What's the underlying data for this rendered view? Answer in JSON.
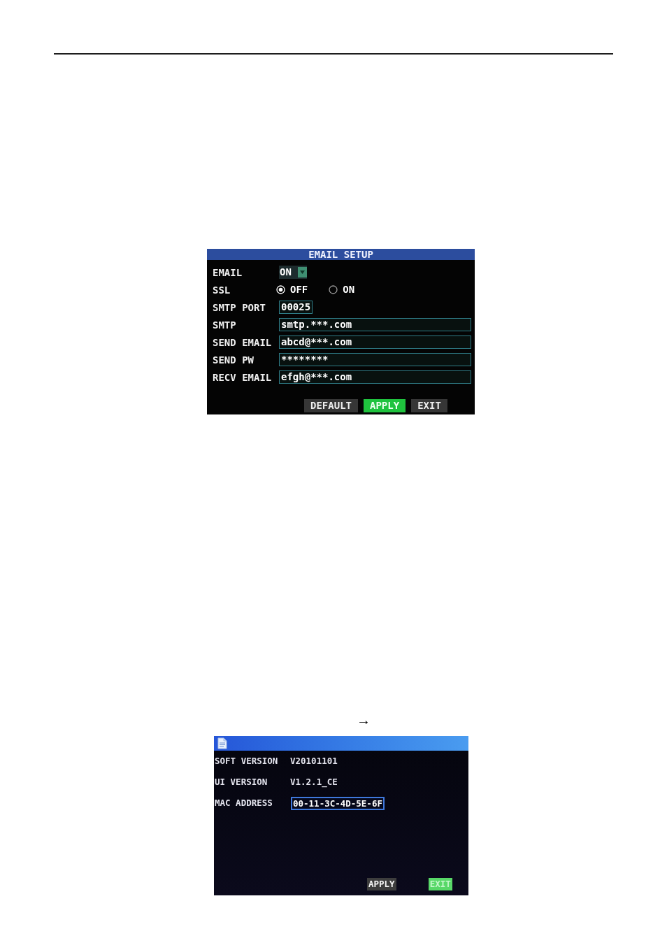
{
  "email_setup": {
    "title": "EMAIL SETUP",
    "fields": [
      {
        "kind": "select",
        "label": "EMAIL",
        "value": "ON"
      },
      {
        "kind": "radio",
        "label": "SSL",
        "options": [
          {
            "label": "OFF",
            "selected": true
          },
          {
            "label": "ON",
            "selected": false
          }
        ]
      },
      {
        "kind": "short_input",
        "label": "SMTP PORT",
        "value": "00025"
      },
      {
        "kind": "input",
        "label": "SMTP",
        "value": "smtp.***.com"
      },
      {
        "kind": "input",
        "label": "SEND EMAIL",
        "value": "abcd@***.com"
      },
      {
        "kind": "input",
        "label": "SEND PW",
        "value": "********"
      },
      {
        "kind": "input",
        "label": "RECV EMAIL",
        "value": "efgh@***.com"
      }
    ],
    "buttons": [
      {
        "label": "DEFAULT",
        "selected": false
      },
      {
        "label": "APPLY",
        "selected": true
      },
      {
        "label": "EXIT",
        "selected": false
      }
    ]
  },
  "arrow": "→",
  "version_info": {
    "rows": [
      {
        "kind": "text",
        "label": "SOFT VERSION",
        "value": "V20101101"
      },
      {
        "kind": "text",
        "label": "UI VERSION",
        "value": "V1.2.1_CE"
      },
      {
        "kind": "input",
        "label": "MAC ADDRESS",
        "value": "00-11-3C-4D-5E-6F"
      }
    ],
    "buttons": [
      {
        "label": "APPLY",
        "selected": false
      },
      {
        "label": "EXIT",
        "selected": true
      }
    ]
  }
}
